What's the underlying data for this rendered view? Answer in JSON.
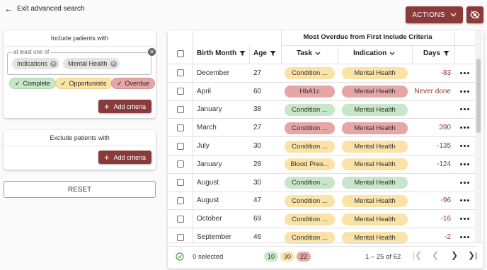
{
  "top": {
    "back_link": "Exit advanced search",
    "actions_label": "ACTIONS"
  },
  "include_panel": {
    "title": "Include patients with",
    "field_label": "at least one of",
    "chips": [
      "Indications",
      "Mental Health"
    ],
    "status_filters": [
      "Complete",
      "Opportunistic",
      "Overdue"
    ],
    "add_label": "Add criteria"
  },
  "exclude_panel": {
    "title": "Exclude patients with",
    "add_label": "Add criteria"
  },
  "reset_label": "RESET",
  "grid": {
    "group_header": "Most Overdue from First Include Criteria",
    "columns": {
      "birth_month": "Birth Month",
      "age": "Age",
      "task": "Task",
      "indication": "Indication",
      "days": "Days"
    },
    "rows": [
      {
        "month": "December",
        "age": "27",
        "task": "Condition ...",
        "task_status": "opportunistic",
        "indication": "Mental Health",
        "ind_status": "opportunistic",
        "days": "-83"
      },
      {
        "month": "April",
        "age": "60",
        "task": "HbA1c",
        "task_status": "overdue",
        "indication": "Mental Health",
        "ind_status": "overdue",
        "days": "Never done"
      },
      {
        "month": "January",
        "age": "38",
        "task": "Condition ...",
        "task_status": "complete",
        "indication": "Mental Health",
        "ind_status": "complete",
        "days": ""
      },
      {
        "month": "March",
        "age": "27",
        "task": "Condition ...",
        "task_status": "overdue",
        "indication": "Mental Health",
        "ind_status": "overdue",
        "days": "390"
      },
      {
        "month": "July",
        "age": "30",
        "task": "Condition ...",
        "task_status": "opportunistic",
        "indication": "Mental Health",
        "ind_status": "opportunistic",
        "days": "-135"
      },
      {
        "month": "January",
        "age": "28",
        "task": "Blood Pres...",
        "task_status": "opportunistic",
        "indication": "Mental Health",
        "ind_status": "opportunistic",
        "days": "-124"
      },
      {
        "month": "August",
        "age": "30",
        "task": "Condition ...",
        "task_status": "complete",
        "indication": "Mental Health",
        "ind_status": "complete",
        "days": ""
      },
      {
        "month": "August",
        "age": "47",
        "task": "Condition ...",
        "task_status": "opportunistic",
        "indication": "Mental Health",
        "ind_status": "opportunistic",
        "days": "-96"
      },
      {
        "month": "October",
        "age": "69",
        "task": "Condition ...",
        "task_status": "opportunistic",
        "indication": "Mental Health",
        "ind_status": "opportunistic",
        "days": "-16"
      },
      {
        "month": "September",
        "age": "46",
        "task": "Condition ...",
        "task_status": "opportunistic",
        "indication": "Mental Health",
        "ind_status": "opportunistic",
        "days": "-2"
      }
    ],
    "footer": {
      "selected": "0 selected",
      "counts": [
        "10",
        "30",
        "22"
      ],
      "range": "1 – 25 of 62"
    }
  },
  "colors": {
    "brand": "#8b3a3a",
    "complete": "#c8e6c9",
    "opportunistic": "#fbe3a8",
    "overdue": "#e6a6a6",
    "days_text": "#8b3a2f"
  },
  "icons": [
    "back-arrow-icon",
    "chevron-down-icon",
    "eye-off-icon",
    "close-icon",
    "check-icon",
    "plus-icon",
    "filter-icon",
    "more-icon",
    "check-circle-icon",
    "first-page-icon",
    "prev-page-icon",
    "next-page-icon",
    "last-page-icon"
  ]
}
